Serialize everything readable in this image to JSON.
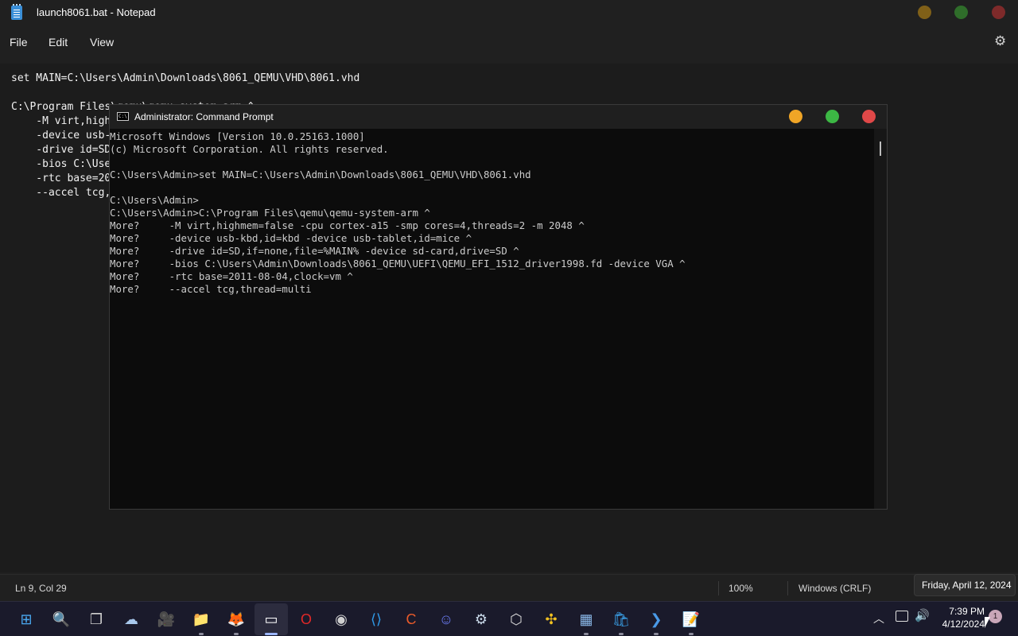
{
  "notepad": {
    "title": "launch8061.bat - Notepad",
    "menu": {
      "file": "File",
      "edit": "Edit",
      "view": "View"
    },
    "editor_text": "set MAIN=C:\\Users\\Admin\\Downloads\\8061_QEMU\\VHD\\8061.vhd\n\nC:\\Program Files\\qemu\\qemu-system-arm ^\n    -M virt,highmem=false -cpu cortex-a15 -smp cores=4,threads=2 -m 2048 ^\n    -device usb-kbd,id=kbd -device usb-tablet,id=mice ^\n    -drive id=SD,if=none,file=%MAIN% -device sd-card,drive=SD ^\n    -bios C:\\Users\\Admin\\Downloads\\8061_QEMU\\UEFI\\QEMU_EFI_1512_driver1998.fd -device VGA ^\n    -rtc base=2011-08-04,clock=vm ^\n    --accel tcg,thread=multi",
    "status": {
      "position": "Ln 9, Col 29",
      "zoom": "100%",
      "line_endings": "Windows (CRLF)"
    }
  },
  "cmd": {
    "title": "Administrator: Command Prompt",
    "icon_text": "C:\\",
    "output": "Microsoft Windows [Version 10.0.25163.1000]\n(c) Microsoft Corporation. All rights reserved.\n\nC:\\Users\\Admin>set MAIN=C:\\Users\\Admin\\Downloads\\8061_QEMU\\VHD\\8061.vhd\n\nC:\\Users\\Admin>\nC:\\Users\\Admin>C:\\Program Files\\qemu\\qemu-system-arm ^\nMore?     -M virt,highmem=false -cpu cortex-a15 -smp cores=4,threads=2 -m 2048 ^\nMore?     -device usb-kbd,id=kbd -device usb-tablet,id=mice ^\nMore?     -drive id=SD,if=none,file=%MAIN% -device sd-card,drive=SD ^\nMore?     -bios C:\\Users\\Admin\\Downloads\\8061_QEMU\\UEFI\\QEMU_EFI_1512_driver1998.fd -device VGA ^\nMore?     -rtc base=2011-08-04,clock=vm ^\nMore?     --accel tcg,thread=multi"
  },
  "taskbar": {
    "apps": [
      {
        "name": "start-icon",
        "glyph": "⊞"
      },
      {
        "name": "search-icon",
        "glyph": "🔍"
      },
      {
        "name": "task-view-icon",
        "glyph": "❐"
      },
      {
        "name": "weather-icon",
        "glyph": "☁"
      },
      {
        "name": "meet-icon",
        "glyph": "🎥"
      },
      {
        "name": "file-explorer-icon",
        "glyph": "📁"
      },
      {
        "name": "firefox-icon",
        "glyph": "🦊"
      },
      {
        "name": "terminal-icon",
        "glyph": "▭"
      },
      {
        "name": "opera-icon",
        "glyph": "O"
      },
      {
        "name": "obs-icon",
        "glyph": "◉"
      },
      {
        "name": "vscode-icon",
        "glyph": "⟨⟩"
      },
      {
        "name": "ccleaner-icon",
        "glyph": "C"
      },
      {
        "name": "discord-icon",
        "glyph": "☺"
      },
      {
        "name": "steam-icon",
        "glyph": "⚙"
      },
      {
        "name": "virtualbox-icon",
        "glyph": "⬡"
      },
      {
        "name": "pinwheel-app-icon",
        "glyph": "✣"
      },
      {
        "name": "resource-monitor-icon",
        "glyph": "▦"
      },
      {
        "name": "store-icon",
        "glyph": "🛍"
      },
      {
        "name": "powershell-icon",
        "glyph": "❯"
      },
      {
        "name": "notepad-icon",
        "glyph": "📝"
      }
    ],
    "time": "7:39 PM",
    "date": "4/12/2024",
    "notification_count": "1",
    "date_tooltip": "Friday, April 12, 2024"
  },
  "colors": {
    "cmd_minimize": "#f0a526",
    "cmd_maximize": "#3cb744",
    "cmd_close": "#e04848",
    "taskbar_bg": "#1a1a2b",
    "notepad_bg": "#1c1c1c"
  }
}
